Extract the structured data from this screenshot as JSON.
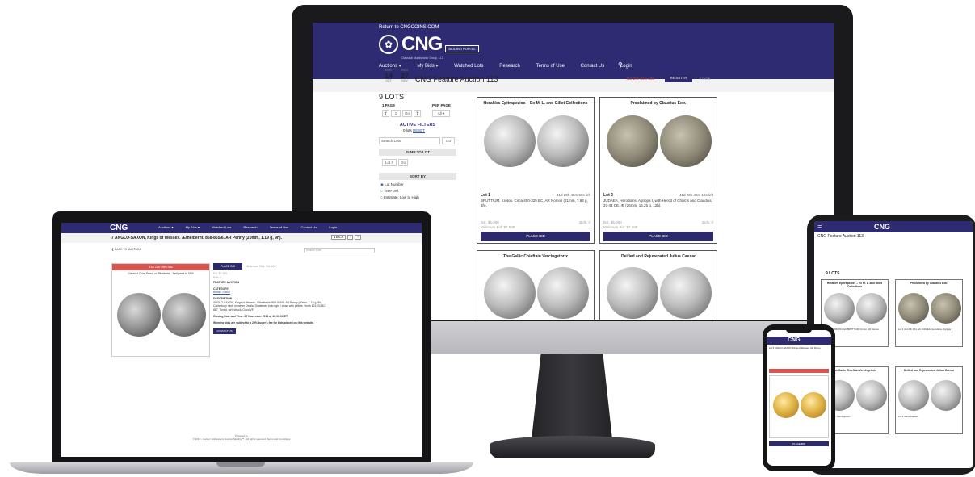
{
  "monitor": {
    "return_link": "Return to CNGCOINS.COM",
    "logo": "CNG",
    "portal_badge": "BIDDING PORTAL",
    "tagline": "Classical Numismatic Group, LLC",
    "nav": [
      "Auctions ▾",
      "My Bids ▾",
      "Watched Lots",
      "Research",
      "Terms of Use",
      "Contact Us",
      "Login"
    ],
    "search_icon": "search-icon",
    "date_start": {
      "dow": "MON",
      "day": "14",
      "mon": "OCT"
    },
    "date_end": {
      "dow": "WED",
      "day": "27",
      "mon": "NOV"
    },
    "auction_title": "CNG Feature Auction 113",
    "time_left": "41d 20h 44m 19s",
    "register_label": "REGISTER",
    "login_label": "LOGIN",
    "lots_count": "9 LOTS",
    "sidebar": {
      "page_label": "1 PAGE",
      "per_page_label": "PER PAGE",
      "prev": "❮",
      "page_value": "1",
      "go": "Go",
      "next": "❯",
      "per_page_value": "All ▾",
      "active_filters_title": "ACTIVE FILTERS",
      "active_filters_text": "0 lots",
      "reset_link": "RESET",
      "search_placeholder": "Search Lots",
      "search_go": "Go",
      "jump_title": "JUMP TO LOT",
      "jump_placeholder": "Lot #",
      "jump_go": "Go",
      "sort_title": "SORT BY",
      "sort_options": [
        "Lot Number",
        "Time Left",
        "Estimate: Low to High"
      ]
    },
    "cards": [
      {
        "title": "Herakles Epitrapezios – Ex M. L. and Gillet Collections",
        "lot": "Lot 1",
        "time_left": "41d 20h 45m 59s left",
        "desc": "BRUTTIUM, Kroton. Circa 400-325 BC. AR Nomos (21mm, 7.63 g, 3h).",
        "estimate": "Est. $5,000",
        "bids": "Bids: 0",
        "min_bid": "Minimum Bid: $2,500",
        "place_bid": "PLACE BID"
      },
      {
        "title": "Proclaimed by Claudius Extr.",
        "lot": "Lot 2",
        "time_left": "41d 20h 46m 19s left",
        "desc": "JUDAEA, Herodians. Agrippa I, with Herod of Chalcis and Claudius. 37-43 CE. Æ (26mm, 16.25 g, 12h).",
        "estimate": "Est. $5,000",
        "bids": "Bids: 0",
        "min_bid": "Minimum Bid: $2,500",
        "place_bid": "PLACE BID"
      },
      {
        "title": "The Gallic Chieftain Vercingetorix"
      },
      {
        "title": "Deified and Rejuvenated Julius Caesar"
      }
    ]
  },
  "laptop": {
    "logo": "CNG",
    "nav": [
      "Auctions ▾",
      "My Bids ▾",
      "Watched Lots",
      "Research",
      "Terms of Use",
      "Contact Us",
      "Login"
    ],
    "lot_title": "7   ANGLO-SAXON, Kings of Wessex. Æthelberht. 858-865/6. AR Penny (20mm, 1.19 g, 9h).",
    "back_link": "❮ BACK TO AUCTION",
    "pager": [
      "◂ BACK",
      "‹",
      "›"
    ],
    "search_placeholder": "Search Lots",
    "time_left": "41d 20h 49m 38s",
    "caption": "Classical Coins Penny of Æthelberht – Pedigreed to 1846",
    "place_bid": "PLACE BID",
    "min_bid": "Minimum Bid: $4,000",
    "est": "Est. $7,500",
    "bids": "Bids: 0",
    "feature_auction": "FEATURE AUCTION",
    "category_label": "CATEGORY",
    "category_value": "British, Saxon",
    "description_label": "DESCRIPTION",
    "description": "ANGLO-SAXON, Kings of Wessex. Æthelberht. 858-865/6. AR Penny (20mm, 1.19 g, 9h). Canterbury mint; moneyer Dealla. Diademed bust right / cross with pellets. North 621; SCBC 887. Toned, well struck. Good VF.",
    "closing_text": "Closing Date and Time: 27 November 2019 at 10:00:00 ET.",
    "winning_text": "Winning bids are subject to a 20% buyer's fee for bids placed on this website.",
    "contact_button": "CONTACT US",
    "powered_by": "Powered by",
    "footer": "© 2019 - Auction Software by Auction Mobility™ - All rights reserved. Terms and Conditions"
  },
  "tablet": {
    "logo": "CNG",
    "title": "CNG Feature Auction 113",
    "lots_count": "9 LOTS",
    "cards": [
      {
        "title": "Herakles Epitrapezios – Ex M. L. and Gillet Collections",
        "info": "Lot 1  41d 20h 45m left  BRUTTIUM, Kroton. AR Nomos."
      },
      {
        "title": "Proclaimed by Claudius Extr.",
        "info": "Lot 2  41d 20h 46m left  JUDAEA, Herodians. Agrippa I."
      },
      {
        "title": "The Gallic Chieftain Vercingetorix",
        "info": "Lot 3  GAUL. Vercingetorix."
      },
      {
        "title": "Deified and Rejuvenated Julius Caesar",
        "info": "Lot 4  Julius Caesar."
      }
    ]
  },
  "phone": {
    "logo": "CNG",
    "lot_text": "Lot 5 ANGLO-SAXON, Kings of Wessex. AR Penny.",
    "place_bid": "PLACE BID"
  }
}
